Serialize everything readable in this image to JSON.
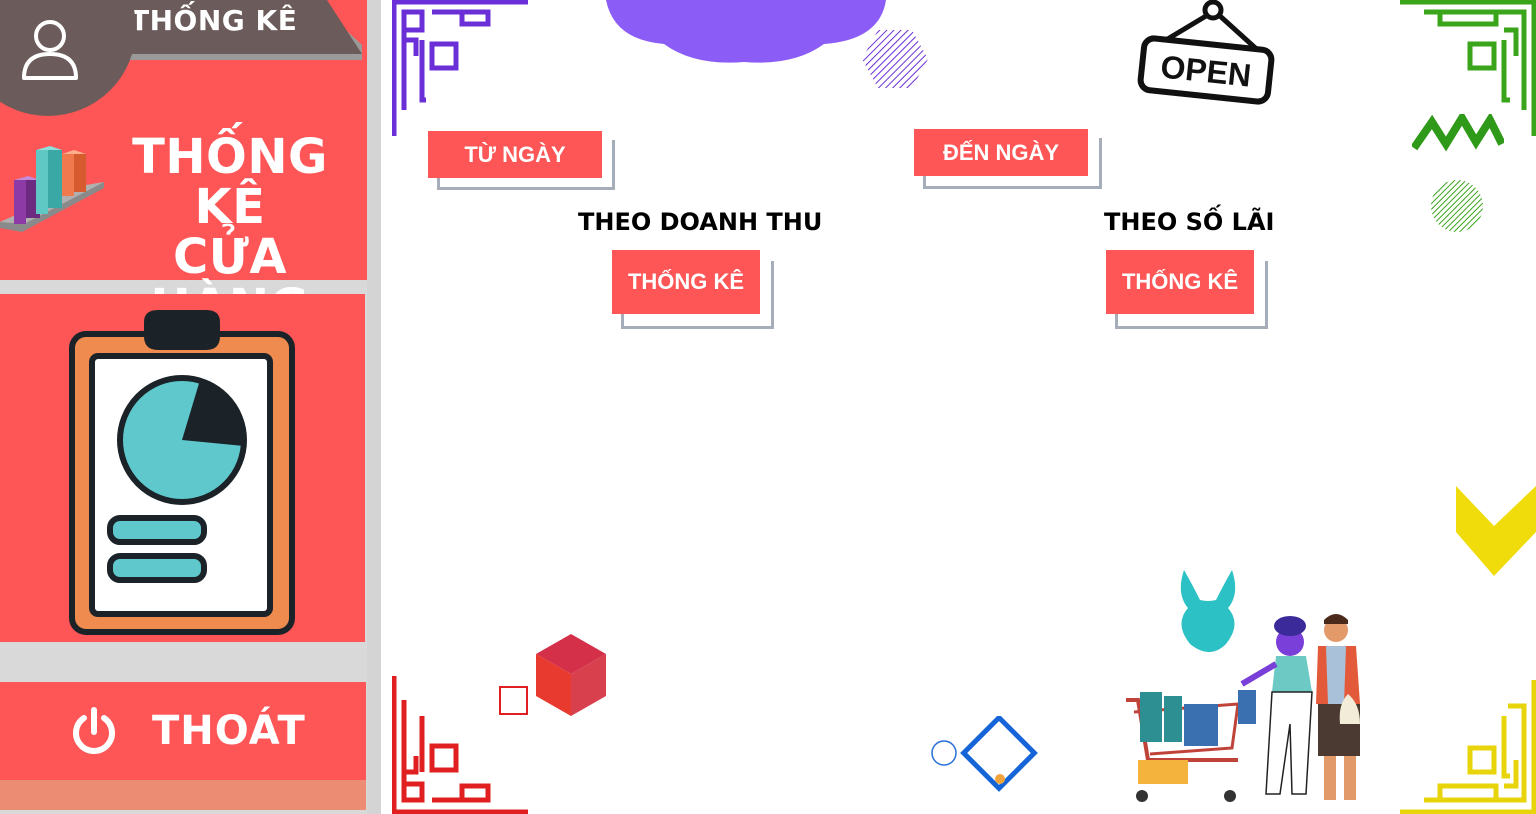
{
  "sidebar": {
    "tab_label": "THỐNG KÊ",
    "brand_line1": "THỐNG KÊ",
    "brand_line2": "CỬA HÀNG",
    "exit_label": "THOÁT"
  },
  "filters": {
    "from_date_label": "TỪ NGÀY",
    "to_date_label": "ĐẾN NGÀY"
  },
  "sections": {
    "revenue_title": "THEO DOANH THU",
    "revenue_button": "THỐNG KÊ",
    "profit_title": "THEO SỐ LÃI",
    "profit_button": "THỐNG KÊ"
  },
  "decor": {
    "open_sign_text": "OPEN"
  },
  "colors": {
    "accent": "#fe5656",
    "tab_dark": "#6b5b5b",
    "purple": "#8b5cf6",
    "shadow_gray": "#a5adb9"
  }
}
